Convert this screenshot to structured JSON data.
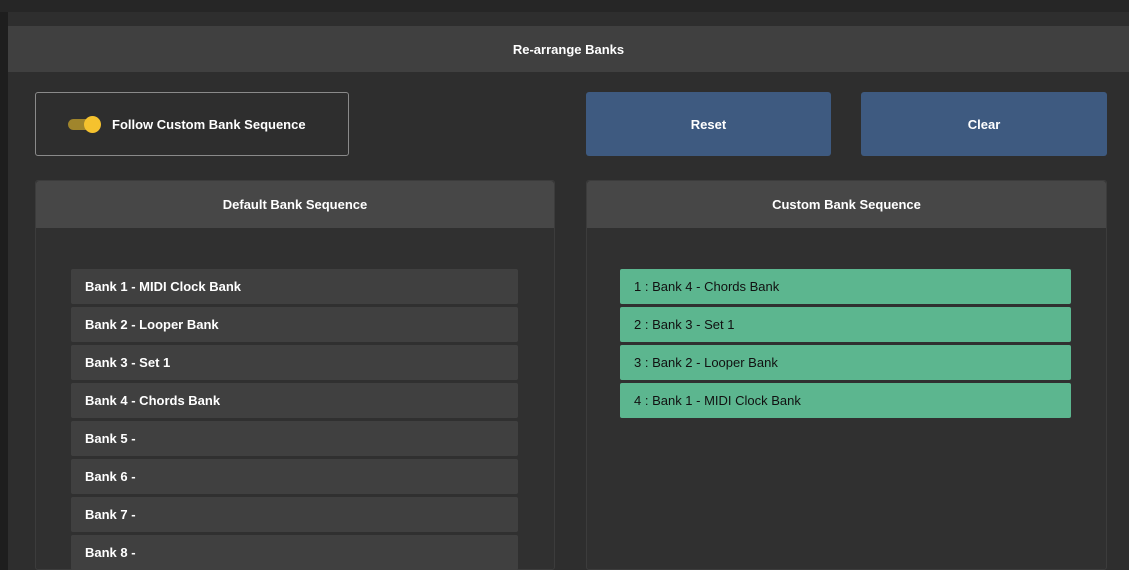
{
  "dialog": {
    "title": "Re-arrange Banks"
  },
  "follow_toggle": {
    "label": "Follow Custom Bank Sequence",
    "enabled": true
  },
  "buttons": {
    "reset_label": "Reset",
    "clear_label": "Clear"
  },
  "default_panel": {
    "title": "Default Bank Sequence",
    "items": [
      "Bank 1 - MIDI Clock Bank",
      "Bank 2 - Looper Bank",
      "Bank 3 - Set 1",
      "Bank 4 - Chords Bank",
      "Bank 5 -",
      "Bank 6 -",
      "Bank 7 -",
      "Bank 8 -"
    ]
  },
  "custom_panel": {
    "title": "Custom Bank Sequence",
    "items": [
      "1 : Bank 4 - Chords Bank",
      "2 : Bank 3 - Set 1",
      "3 : Bank 2 - Looper Bank",
      "4 : Bank 1 - MIDI Clock Bank"
    ]
  },
  "colors": {
    "button_blue": "#3e5a80",
    "custom_item_green": "#5cb68f",
    "toggle_yellow": "#f5c22e"
  }
}
